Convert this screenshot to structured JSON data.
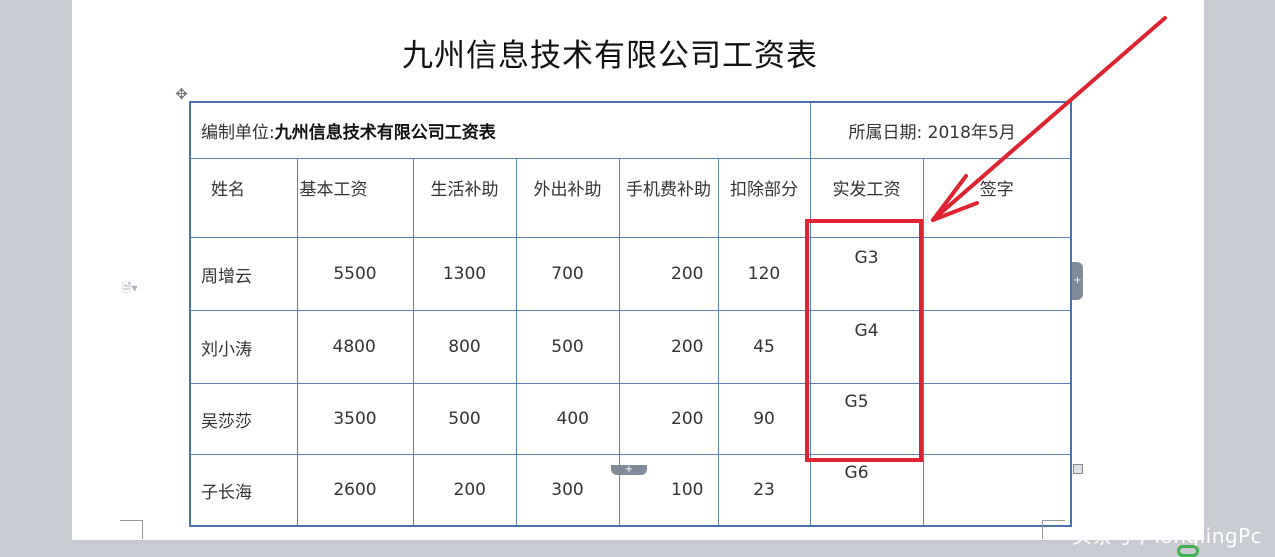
{
  "document": {
    "title": "九州信息技术有限公司工资表"
  },
  "table": {
    "org_label": "编制单位:",
    "org_value": "九州信息技术有限公司工资表",
    "date_label": "所属日期: 2018年5月",
    "headers": [
      "姓名",
      "基本工资",
      "生活补助",
      "外出补助",
      "手机费补助",
      "扣除部分",
      "实发工资",
      "签字"
    ],
    "rows": [
      {
        "name": "周增云",
        "base": "5500",
        "living": "1300",
        "travel": "700",
        "phone": "200",
        "deduct": "120",
        "net": "G3",
        "sign": ""
      },
      {
        "name": "刘小涛",
        "base": "4800",
        "living": "800",
        "travel": "500",
        "phone": "200",
        "deduct": "45",
        "net": "G4",
        "sign": ""
      },
      {
        "name": "吴莎莎",
        "base": "3500",
        "living": "500",
        "travel": "400",
        "phone": "200",
        "deduct": "90",
        "net": "G5",
        "sign": ""
      },
      {
        "name": "子长海",
        "base": "2600",
        "living": "200",
        "travel": "300",
        "phone": "100",
        "deduct": "23",
        "net": "G6",
        "sign": ""
      }
    ]
  },
  "watermark": "头条号 / longlingPc",
  "colors": {
    "highlight": "#e02331",
    "formula_text": "#e0141e",
    "table_border": "#4a72a8"
  },
  "icons": {
    "move_handle": "move-arrows-icon",
    "side": "document-options-icon",
    "row_add": "plus-icon",
    "col_add": "plus-icon"
  }
}
